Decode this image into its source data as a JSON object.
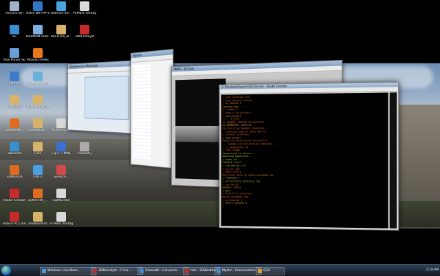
{
  "desktop_icons": [
    {
      "label": "Recycle Bin",
      "color": "#9fb3c8"
    },
    {
      "label": "ASUS WiFi-AP Solo",
      "color": "#2e78c7"
    },
    {
      "label": "daemon-40...",
      "color": "#4aa3df"
    },
    {
      "label": "PCMark Vantage",
      "color": "#d9d9d9"
    },
    {
      "label": "SE",
      "color": "#3a8fd0"
    },
    {
      "label": "DAEMON Tools Lite",
      "color": "#7faee0"
    },
    {
      "label": "daeTLXw_N...",
      "color": "#d7b36a"
    },
    {
      "label": "3DM Analyst",
      "color": "#c62b2b"
    },
    {
      "label": "Mail Player SE",
      "color": "#6aa0d8"
    },
    {
      "label": "Mozilla Firefox",
      "color": "#e8781c"
    },
    {
      "label": "SafiPuZ",
      "color": "#3d7dc7"
    },
    {
      "label": "3DMark Vantage",
      "color": "#6bb0d9"
    },
    {
      "label": "Ree2250",
      "color": "#d7b36a"
    },
    {
      "label": "3DM Analyst Mini Mini",
      "color": "#d7b36a"
    },
    {
      "label": "3DMark06...",
      "color": "#e06b1f"
    },
    {
      "label": "aomdpfp8...",
      "color": "#d7b36a"
    },
    {
      "label": "PCMark05...",
      "color": "#d9d9d9"
    },
    {
      "label": "bcmm 3.50...",
      "color": "#c8c8c8"
    },
    {
      "label": "wbemlist",
      "color": "#3a8fd0"
    },
    {
      "label": "Files",
      "color": "#d7b36a"
    },
    {
      "label": "Fxp 1.7.MME",
      "color": "#3a6fd0"
    },
    {
      "label": "ezeneBFJ",
      "color": "#aaaaaa"
    },
    {
      "label": "3DMark06",
      "color": "#e06b1f"
    },
    {
      "label": "CPU-Z",
      "color": "#4a9fe0"
    },
    {
      "label": "GeForce...",
      "color": "#d14a4a"
    },
    {
      "label": "Adobe Acrobat 8...",
      "color": "#c62b2b"
    },
    {
      "label": "3DMark06_...",
      "color": "#e06b1f"
    },
    {
      "label": "LightScribe",
      "color": "#d9d9d9"
    },
    {
      "label": "Antivir PC Classic",
      "color": "#c62b2b"
    },
    {
      "label": "adobepdf.dll",
      "color": "#d7b36a"
    },
    {
      "label": "PCMark Vantage x64",
      "color": "#d9d9d9"
    }
  ],
  "windows": [
    {
      "title": "Windows Live Messenger",
      "color": "#e5ecf4"
    },
    {
      "title": "Explorer",
      "color": "#f3f3f3"
    },
    {
      "title": "RMMV - 3D View",
      "color": "#101010"
    },
    {
      "title": "Console",
      "color": "#000000"
    }
  ],
  "terminal": {
    "title": "C:\\Windows\\System32\\cmd.exe - Quake Console",
    "lines": [
      {
        "text": "] exec autoexec.cfg",
        "color": "#d06b2a"
      },
      {
        "text": "] bind mouse1 +attack",
        "color": "#d06b2a"
      },
      {
        "text": "] sv_cheats 1",
        "color": "#e0a030"
      },
      {
        "text": "Loading map...",
        "color": "#e0a030"
      },
      {
        "text": "] r_mode 6",
        "color": "#d06b2a"
      },
      {
        "text": "] seta r_fullscreen 1",
        "color": "#d06b2a"
      },
      {
        "text": "] vid_restart",
        "color": "#e0a030"
      },
      {
        "text": "----- R_Init -----",
        "color": "#d06b2a"
      },
      {
        "text": "GL_VENDOR: NVIDIA Corporation",
        "color": "#d06b2a"
      },
      {
        "text": "GL_RENDERER: GeForce",
        "color": "#e0a030"
      },
      {
        "text": "Initializing OpenGL subsystem",
        "color": "#d06b2a"
      },
      {
        "text": "...setting mode 6: 1024 768 FS",
        "color": "#d06b2a"
      },
      {
        "text": "] connect localhost",
        "color": "#d06b2a"
      },
      {
        "text": "] name player",
        "color": "#e0a030"
      },
      {
        "text": "Sound initialization successful.",
        "color": "#d06b2a"
      },
      {
        "text": "--- Common Initialization Complete ---",
        "color": "#d06b2a"
      },
      {
        "text": "] cl_maxpackets 30",
        "color": "#d06b2a"
      },
      {
        "text": "] rate 25000",
        "color": "#d06b2a"
      },
      {
        "text": "Connecting to server...",
        "color": "#c0c030"
      },
      {
        "text": "Awaiting gamestate...",
        "color": "#c0c030"
      },
      {
        "text": "] snaps 40",
        "color": "#9ac030"
      },
      {
        "text": "Loading level...",
        "color": "#c0c030"
      },
      {
        "text": "] com_maxfps 125",
        "color": "#9ac030"
      },
      {
        "text": "] cg_fov 110",
        "color": "#d06b2a"
      },
      {
        "text": "] demo record",
        "color": "#d06b2a"
      },
      {
        "text": "Recording demo to demos/demo0001.dm",
        "color": "#d06b2a"
      },
      {
        "text": "] timedemo 1",
        "color": "#e0a030"
      },
      {
        "text": "] writeconfig q3config.cfg",
        "color": "#9ac030"
      },
      {
        "text": "] say hello",
        "color": "#d06b2a"
      },
      {
        "text": "player: hello",
        "color": "#e0a030"
      },
      {
        "text": "] quit",
        "color": "#9ac030"
      },
      {
        "text": "] bind F12 screenshot",
        "color": "#d06b2a"
      },
      {
        "text": "Wrote shot0001.tga",
        "color": "#d06b2a"
      },
      {
        "text": "] cg_drawfps 1",
        "color": "#d06b2a"
      },
      {
        "text": "] seta r_picmip 0",
        "color": "#e0a030"
      },
      {
        "text": "]",
        "color": "#d06b2a"
      }
    ]
  },
  "taskbar": {
    "tasks": [
      {
        "label": "Windows Live Mess...",
        "color": "#4a9fe0"
      },
      {
        "label": "3DMAnalyst - C:\\Us...",
        "color": "#c62b2b"
      },
      {
        "label": "Zarneeth - Conversa...",
        "color": "#3a8fd0"
      },
      {
        "label": "mlb - 3DWeather2...",
        "color": "#c62b2b"
      },
      {
        "label": "Mystic - Conversation",
        "color": "#3a8fd0"
      },
      {
        "label": "Q3A",
        "color": "#e0a030"
      }
    ],
    "clock": "2:18 PM"
  }
}
